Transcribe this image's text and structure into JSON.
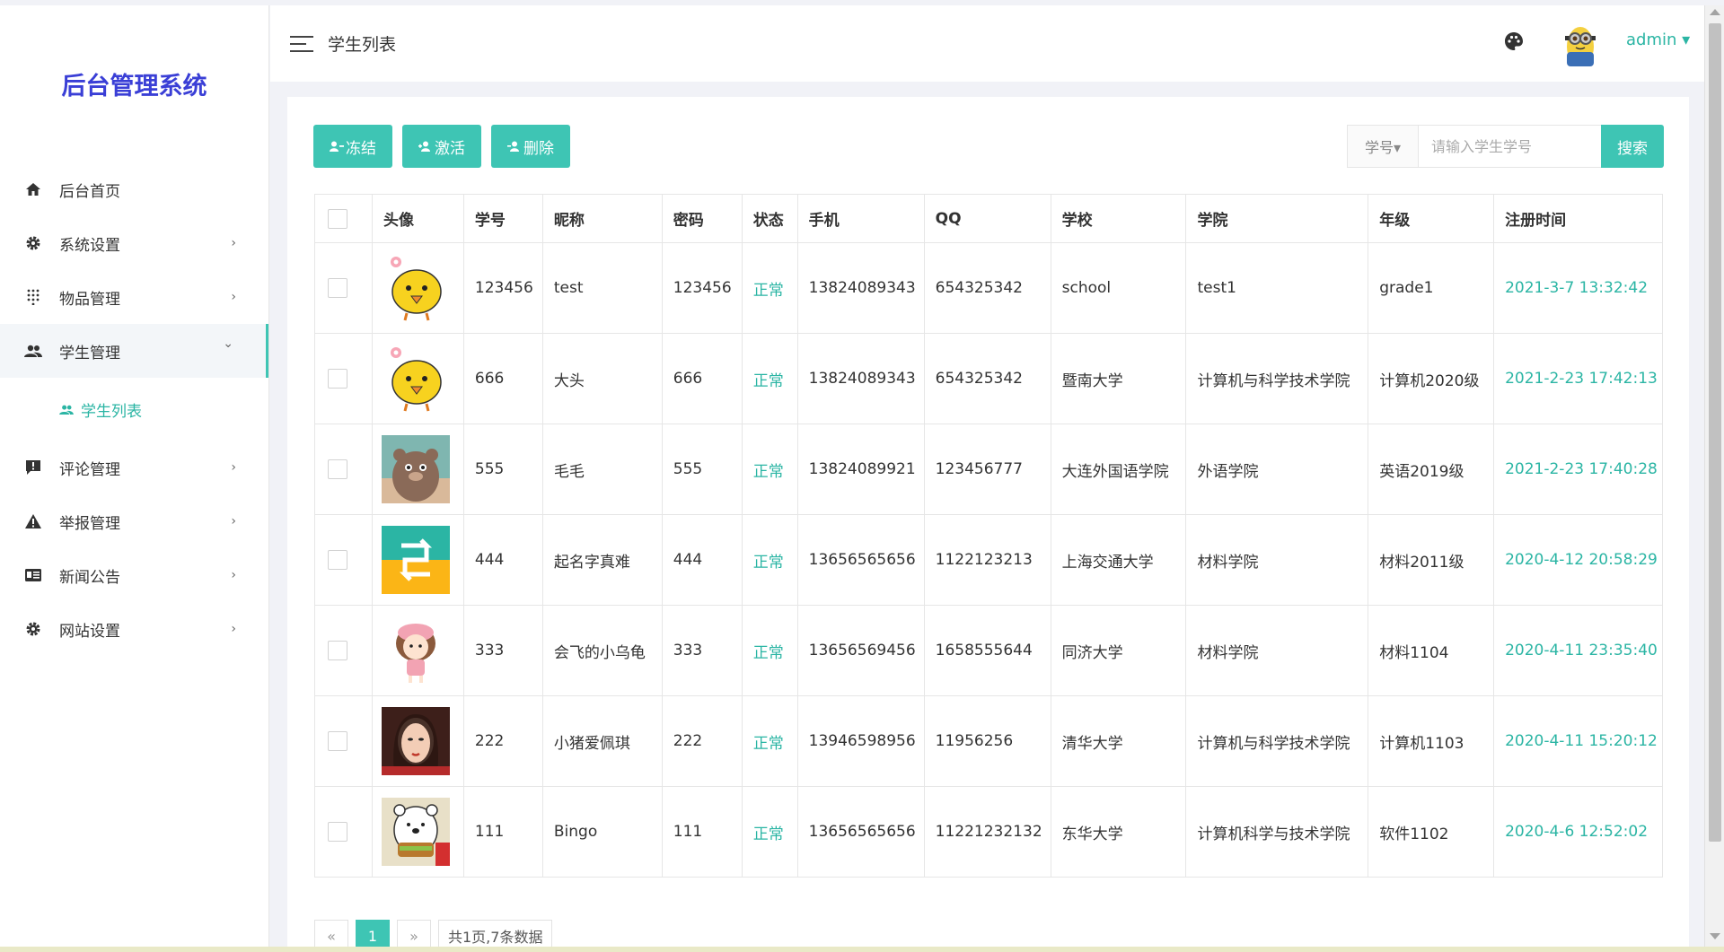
{
  "sidebar": {
    "brand": "后台管理系统",
    "items": [
      {
        "label": "后台首页",
        "icon": "home-icon",
        "arrow": ""
      },
      {
        "label": "系统设置",
        "icon": "gear-icon",
        "arrow": "›"
      },
      {
        "label": "物品管理",
        "icon": "grid-dots-icon",
        "arrow": "›"
      },
      {
        "label": "学生管理",
        "icon": "people-icon",
        "arrow": "⌄"
      },
      {
        "label": "评论管理",
        "icon": "comment-icon",
        "arrow": "›"
      },
      {
        "label": "举报管理",
        "icon": "warning-icon",
        "arrow": "›"
      },
      {
        "label": "新闻公告",
        "icon": "news-icon",
        "arrow": "›"
      },
      {
        "label": "网站设置",
        "icon": "gear-icon",
        "arrow": "›"
      }
    ],
    "sub_item": {
      "label": "学生列表",
      "icon": "people-icon"
    }
  },
  "header": {
    "title": "学生列表",
    "user": "admin ▾"
  },
  "toolbar": {
    "freeze_label": "冻结",
    "activate_label": "激活",
    "delete_label": "删除",
    "search_select": "学号▾",
    "search_placeholder": "请输入学生学号",
    "search_label": "搜索"
  },
  "table": {
    "columns": [
      "头像",
      "学号",
      "昵称",
      "密码",
      "状态",
      "手机",
      "QQ",
      "学校",
      "学院",
      "年级",
      "注册时间"
    ],
    "rows": [
      {
        "avatar": "chick",
        "id": "123456",
        "nick": "test",
        "pwd": "123456",
        "status": "正常",
        "phone": "13824089343",
        "qq": "654325342",
        "school": "school",
        "college": "test1",
        "grade": "grade1",
        "time": "2021-3-7 13:32:42"
      },
      {
        "avatar": "chick",
        "id": "666",
        "nick": "大头",
        "pwd": "666",
        "status": "正常",
        "phone": "13824089343",
        "qq": "654325342",
        "school": "暨南大学",
        "college": "计算机与科学技术学院",
        "grade": "计算机2020级",
        "time": "2021-2-23 17:42:13"
      },
      {
        "avatar": "bear",
        "id": "555",
        "nick": "毛毛",
        "pwd": "555",
        "status": "正常",
        "phone": "13824089921",
        "qq": "123456777",
        "school": "大连外国语学院",
        "college": "外语学院",
        "grade": "英语2019级",
        "time": "2021-2-23 17:40:28"
      },
      {
        "avatar": "arrows",
        "id": "444",
        "nick": "起名字真难",
        "pwd": "444",
        "status": "正常",
        "phone": "13656565656",
        "qq": "1122123213",
        "school": "上海交通大学",
        "college": "材料学院",
        "grade": "材料2011级",
        "time": "2020-4-12 20:58:29"
      },
      {
        "avatar": "girl",
        "id": "333",
        "nick": "会飞的小乌龟",
        "pwd": "333",
        "status": "正常",
        "phone": "13656569456",
        "qq": "1658555644",
        "school": "同济大学",
        "college": "材料学院",
        "grade": "材料1104",
        "time": "2020-4-11 23:35:40"
      },
      {
        "avatar": "photo",
        "id": "222",
        "nick": "小猪爱佩琪",
        "pwd": "222",
        "status": "正常",
        "phone": "13946598956",
        "qq": "11956256",
        "school": "清华大学",
        "college": "计算机与科学技术学院",
        "grade": "计算机1103",
        "time": "2020-4-11 15:20:12"
      },
      {
        "avatar": "polar",
        "id": "111",
        "nick": "Bingo",
        "pwd": "111",
        "status": "正常",
        "phone": "13656565656",
        "qq": "11221232132",
        "school": "东华大学",
        "college": "计算机科学与技术学院",
        "grade": "软件1102",
        "time": "2020-4-6 12:52:02"
      }
    ]
  },
  "pager": {
    "prev": "«",
    "current": "1",
    "next": "»",
    "info": "共1页,7条数据"
  },
  "colors": {
    "accent": "#3ec5b4",
    "brand": "#3a3fd6"
  }
}
